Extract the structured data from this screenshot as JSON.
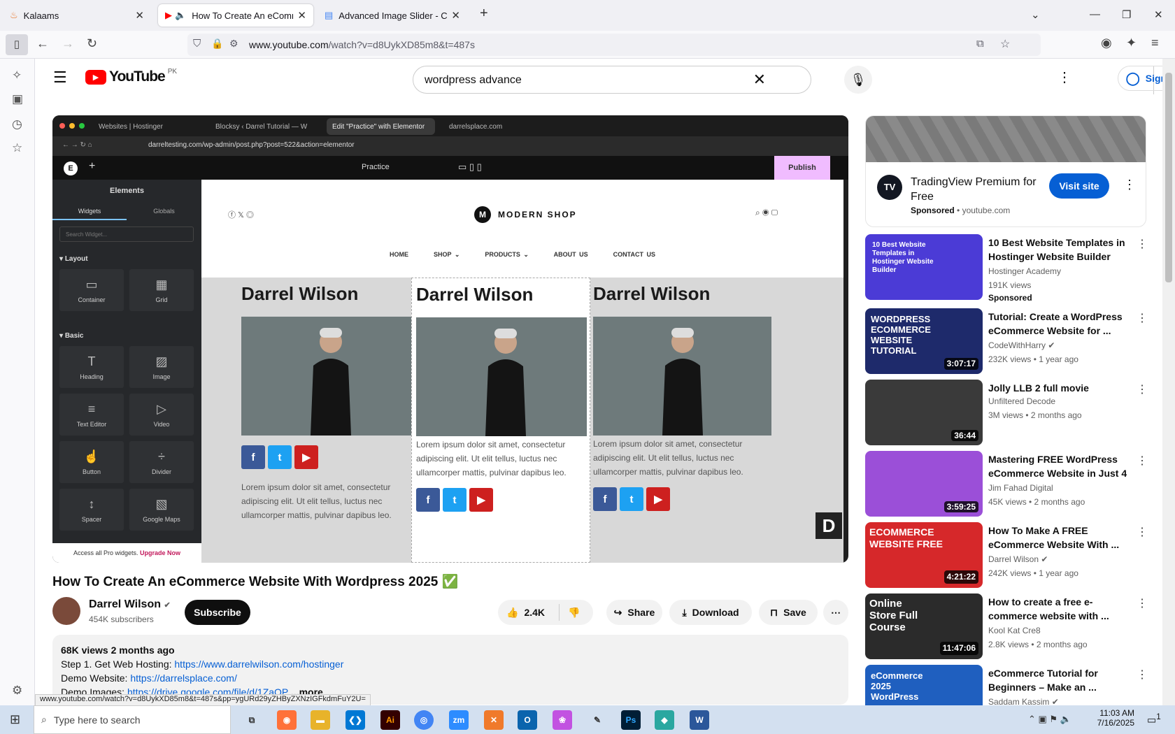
{
  "browser": {
    "tabs": [
      {
        "title": "Kalaams",
        "close": "✕"
      },
      {
        "title": "How To Create An eCommerce",
        "close": "✕"
      },
      {
        "title": "Advanced Image Slider - Code",
        "close": "✕"
      }
    ],
    "new_tab": "+",
    "url_domain": "www.youtube.com",
    "url_path": "/watch?v=d8UykXD85m8&t=487s"
  },
  "youtube": {
    "logo_text": "YouTube",
    "region": "PK",
    "search_value": "wordpress advance",
    "sign_in": "Sign in"
  },
  "player": {
    "tabs": [
      "Websites | Hostinger",
      "Blocksy ‹ Darrel Tutorial — W",
      "Edit \"Practice\" with Elementor",
      "darrelsplace.com"
    ],
    "url": "darreltesting.com/wp-admin/post.php?post=522&action=elementor",
    "page_select": "Practice",
    "publish": "Publish",
    "panel_title": "Elements",
    "panel_tabs": [
      "Widgets",
      "Globals"
    ],
    "search_placeholder": "Search Widget...",
    "section_layout": "Layout",
    "section_basic": "Basic",
    "widgets": [
      "Container",
      "Grid",
      "Heading",
      "Image",
      "Text Editor",
      "Video",
      "Button",
      "Divider",
      "Spacer",
      "Google Maps"
    ],
    "pro_text": "Access all Pro widgets.",
    "upgrade": "Upgrade Now",
    "shop_logo": "MODERN SHOP",
    "nav": [
      "HOME",
      "SHOP",
      "PRODUCTS",
      "ABOUT US",
      "CONTACT US"
    ],
    "card_name": "Darrel Wilson",
    "lorem": "Lorem ipsum dolor sit amet, consectetur adipiscing elit. Ut elit tellus, luctus nec ullamcorper mattis, pulvinar dapibus leo."
  },
  "video": {
    "title": "How To Create An eCommerce Website With Wordpress 2025 ✅",
    "channel": "Darrel Wilson",
    "subscribers": "454K subscribers",
    "subscribe": "Subscribe",
    "likes": "2.4K",
    "share": "Share",
    "download": "Download",
    "save": "Save",
    "views_date": "68K views  2 months ago",
    "desc_line1_label": "Step 1. Get Web Hosting: ",
    "desc_line1_link": "https://www.darrelwilson.com/hostinger",
    "desc_line2_label": "Demo Website: ",
    "desc_line2_link": "https://darrelsplace.com/",
    "desc_line3_label": "Demo Images: ",
    "desc_line3_link": "https://drive.google.com/file/d/1ZaOP",
    "more": "...more",
    "status_url": "www.youtube.com/watch?v=d8UykXD85m8&t=487s&pp=ygURd29yZHByZXNzIGFkdmFuY2U="
  },
  "ad": {
    "title": "TradingView Premium for Free",
    "sponsored": "Sponsored",
    "domain": "youtube.com",
    "cta": "Visit site"
  },
  "related": [
    {
      "title": "10 Best Website Templates in Hostinger Website Builder",
      "channel": "Hostinger Academy",
      "meta": "191K views",
      "extra": "Sponsored",
      "duration": "",
      "thumb_text": "10 Best Website Templates in Hostinger Website Builder",
      "thumb_color": "#4b3bd6"
    },
    {
      "title": "Tutorial: Create a WordPress eCommerce Website for ...",
      "channel": "CodeWithHarry",
      "meta": "232K views • 1 year ago",
      "extra": "",
      "duration": "3:07:17",
      "thumb_text": "WORDPRESS ECOMMERCE WEBSITE TUTORIAL",
      "thumb_color": "#1e2a6b"
    },
    {
      "title": "Jolly LLB 2 full movie",
      "channel": "Unfiltered Decode",
      "meta": "3M views • 2 months ago",
      "extra": "",
      "duration": "36:44",
      "thumb_text": "",
      "thumb_color": "#3a3a3a"
    },
    {
      "title": "Mastering FREE WordPress eCommerce Website in Just 4 ...",
      "channel": "Jim Fahad Digital",
      "meta": "45K views • 2 months ago",
      "extra": "",
      "duration": "3:59:25",
      "thumb_text": "",
      "thumb_color": "#9b4fd8"
    },
    {
      "title": "How To Make A FREE eCommerce Website With ...",
      "channel": "Darrel Wilson",
      "meta": "242K views • 1 year ago",
      "extra": "",
      "duration": "4:21:22",
      "thumb_text": "ECOMMERCE WEBSITE FREE",
      "thumb_color": "#d6282a"
    },
    {
      "title": "How to create a free e-commerce website with ...",
      "channel": "Kool Kat Cre8",
      "meta": "2.8K views • 2 months ago",
      "extra": "",
      "duration": "11:47:06",
      "thumb_text": "Online Store Full Course",
      "thumb_color": "#2b2b2b"
    },
    {
      "title": "eCommerce Tutorial for Beginners – Make an ...",
      "channel": "Saddam Kassim",
      "meta": "",
      "extra": "",
      "duration": "",
      "thumb_text": "eCommerce 2025 WordPress",
      "thumb_color": "#1f5fbf"
    }
  ],
  "taskbar": {
    "search_placeholder": "Type here to search",
    "time": "11:03 AM",
    "date": "7/16/2025",
    "notif_count": "1"
  },
  "colors": {
    "yt_red": "#ff0000",
    "link_blue": "#065fd4",
    "publish_pink": "#f0bcff"
  }
}
